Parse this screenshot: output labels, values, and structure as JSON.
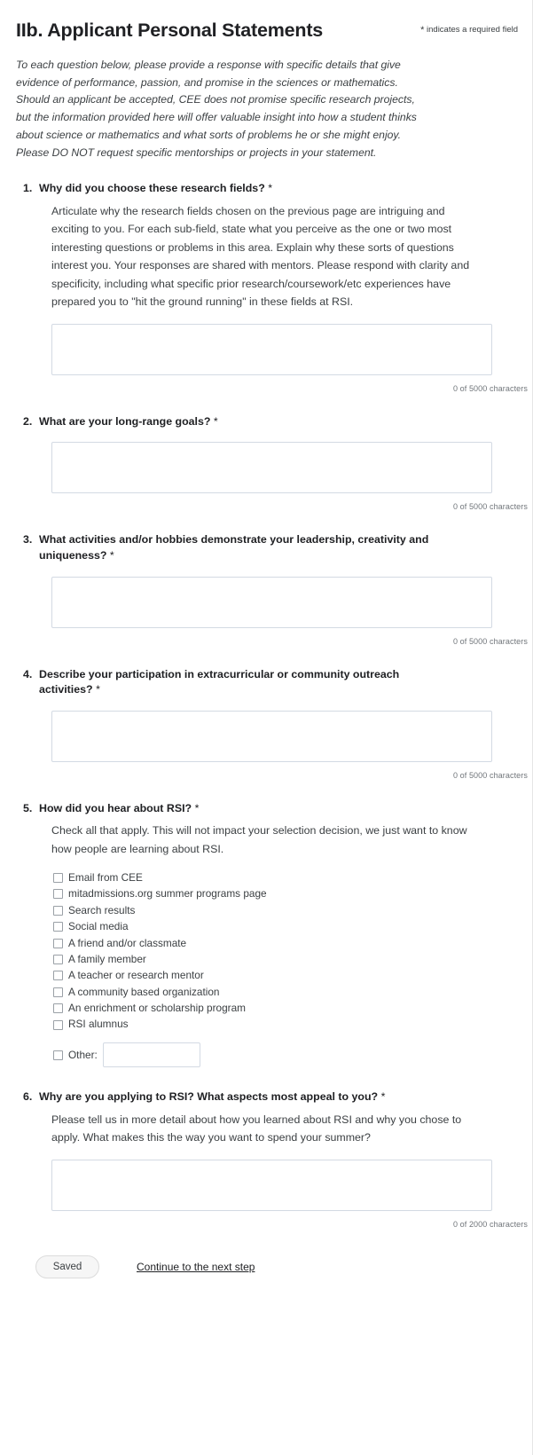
{
  "header": {
    "title": "IIb. Applicant Personal Statements",
    "required_star": "*",
    "required_note": "indicates a required field"
  },
  "intro": {
    "lines": [
      "To each question below, please provide a response with specific details that give",
      "evidence of performance, passion, and promise in the sciences or mathematics.",
      "Should an applicant be accepted, CEE does not promise specific research projects,",
      "but the information provided here will offer valuable insight into how a student thinks",
      "about science or mathematics and what sorts of problems he or she might enjoy.",
      "Please DO NOT request specific mentorships or projects in your statement."
    ]
  },
  "questions": [
    {
      "number": "1.",
      "title": "Why did you choose these research fields?",
      "required": "*",
      "description": "Articulate why the research fields chosen on the previous page are intriguing and exciting to you. For each sub-field, state what you perceive as the one or two most interesting questions or problems in this area.  Explain why these sorts of questions interest you. Your responses are shared with mentors. Please respond with clarity and specificity, including what specific prior research/coursework/etc experiences have prepared you to \"hit the ground running\" in these fields at RSI.",
      "value": "",
      "counter": "0 of 5000 characters"
    },
    {
      "number": "2.",
      "title": "What are your long-range goals?",
      "required": "*",
      "description": "",
      "value": "",
      "counter": "0 of 5000 characters"
    },
    {
      "number": "3.",
      "title": "What activities and/or hobbies demonstrate your leadership, creativity and uniqueness?",
      "required": "*",
      "description": "",
      "value": "",
      "counter": "0 of 5000 characters"
    },
    {
      "number": "4.",
      "title": "Describe your participation in extracurricular or community outreach activities?",
      "required": "*",
      "description": "",
      "value": "",
      "counter": "0 of 5000 characters"
    },
    {
      "number": "5.",
      "title": "How did you hear about RSI?",
      "required": "*",
      "description": "Check all that apply. This will not impact your selection decision, we just want to know how people are learning about RSI.",
      "options": [
        "Email from CEE",
        "mitadmissions.org summer programs page",
        "Search results",
        "Social media",
        "A friend and/or classmate",
        "A family member",
        "A teacher or research mentor",
        "A community based organization",
        "An enrichment or scholarship program",
        "RSI alumnus"
      ],
      "other_label": "Other:",
      "other_value": ""
    },
    {
      "number": "6.",
      "title": "Why are you applying to RSI? What aspects most appeal to you?",
      "required": "*",
      "description": "Please tell us in more detail about how you learned about RSI and why you chose to apply. What makes this the way you want to spend your summer?",
      "value": "",
      "counter": "0 of 2000 characters"
    }
  ],
  "footer": {
    "saved_label": "Saved",
    "continue_label": "Continue to the next step"
  },
  "colors": {
    "text": "#3c4043",
    "heading": "#202124",
    "border": "#d3dae3",
    "muted": "#70757a",
    "button_bg": "#f6f6f6"
  }
}
